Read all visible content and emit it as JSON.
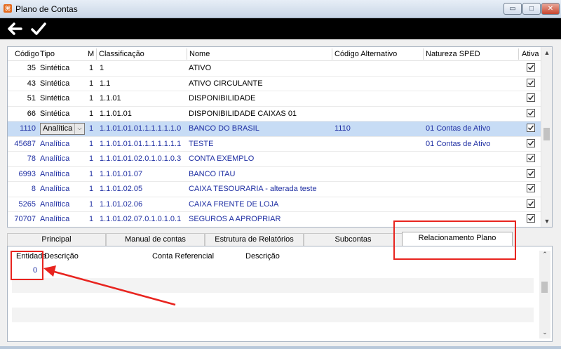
{
  "window": {
    "title": "Plano de Contas",
    "app_icon": "cube-icon",
    "buttons": {
      "minimize": "▭",
      "maximize": "□",
      "close": "✕"
    }
  },
  "toolbar": {
    "back_icon": "arrow-left-icon",
    "confirm_icon": "checkmark-icon"
  },
  "grid": {
    "columns": {
      "codigo": "Código",
      "tipo": "Tipo",
      "m": "M",
      "classificacao": "Classificação",
      "nome": "Nome",
      "codigo_alternativo": "Código Alternativo",
      "natureza_sped": "Natureza SPED",
      "ativa": "Ativa"
    },
    "rows": [
      {
        "codigo": "35",
        "tipo": "Sintética",
        "m": "1",
        "classificacao": "1",
        "nome": "ATIVO",
        "codigo_alternativo": "",
        "natureza_sped": "",
        "ativa": true
      },
      {
        "codigo": "43",
        "tipo": "Sintética",
        "m": "1",
        "classificacao": "1.1",
        "nome": "ATIVO CIRCULANTE",
        "codigo_alternativo": "",
        "natureza_sped": "",
        "ativa": true
      },
      {
        "codigo": "51",
        "tipo": "Sintética",
        "m": "1",
        "classificacao": "1.1.01",
        "nome": "DISPONIBILIDADE",
        "codigo_alternativo": "",
        "natureza_sped": "",
        "ativa": true
      },
      {
        "codigo": "66",
        "tipo": "Sintética",
        "m": "1",
        "classificacao": "1.1.01.01",
        "nome": "DISPONIBILIDADE CAIXAS 01",
        "codigo_alternativo": "",
        "natureza_sped": "",
        "ativa": true
      },
      {
        "codigo": "1110",
        "tipo": "Analítica",
        "m": "1",
        "classificacao": "1.1.01.01.01.1.1.1.1.1.0",
        "nome": "BANCO DO BRASIL",
        "codigo_alternativo": "1110",
        "natureza_sped": "01 Contas de Ativo",
        "ativa": true
      },
      {
        "codigo": "45687",
        "tipo": "Analítica",
        "m": "1",
        "classificacao": "1.1.01.01.01.1.1.1.1.1.1",
        "nome": "TESTE",
        "codigo_alternativo": "",
        "natureza_sped": "01 Contas de Ativo",
        "ativa": true
      },
      {
        "codigo": "78",
        "tipo": "Analítica",
        "m": "1",
        "classificacao": "1.1.01.01.02.0.1.0.1.0.3",
        "nome": "CONTA EXEMPLO",
        "codigo_alternativo": "",
        "natureza_sped": "",
        "ativa": true
      },
      {
        "codigo": "6993",
        "tipo": "Analítica",
        "m": "1",
        "classificacao": "1.1.01.01.07",
        "nome": "BANCO ITAU",
        "codigo_alternativo": "",
        "natureza_sped": "",
        "ativa": true
      },
      {
        "codigo": "8",
        "tipo": "Analítica",
        "m": "1",
        "classificacao": "1.1.01.02.05",
        "nome": "CAIXA TESOURARIA - alterada teste",
        "codigo_alternativo": "",
        "natureza_sped": "",
        "ativa": true
      },
      {
        "codigo": "5265",
        "tipo": "Analítica",
        "m": "1",
        "classificacao": "1.1.01.02.06",
        "nome": "CAIXA FRENTE DE LOJA",
        "codigo_alternativo": "",
        "natureza_sped": "",
        "ativa": true
      },
      {
        "codigo": "70707",
        "tipo": "Analítica",
        "m": "1",
        "classificacao": "1.1.01.02.07.0.1.0.1.0.1",
        "nome": "SEGUROS A APROPRIAR",
        "codigo_alternativo": "",
        "natureza_sped": "",
        "ativa": true
      }
    ],
    "selected_row": 4,
    "combo_arrow": "⌵"
  },
  "tabs": [
    {
      "label": "Principal",
      "active": false
    },
    {
      "label": "Manual de contas",
      "active": false
    },
    {
      "label": "Estrutura de Relatórios",
      "active": false
    },
    {
      "label": "Subcontas",
      "active": false
    },
    {
      "label": "Relacionamento Plano Referencial",
      "active": true
    }
  ],
  "panel": {
    "columns": {
      "entidade": "Entidade",
      "descricao1": "Descrição",
      "conta_referencial": "Conta Referencial",
      "descricao2": "Descrição"
    },
    "rows": [
      {
        "entidade": "0"
      }
    ]
  },
  "colors": {
    "annotation_red": "#e8241f",
    "selection": "#c7dcf5",
    "analitica_text": "#1f2fa3"
  }
}
